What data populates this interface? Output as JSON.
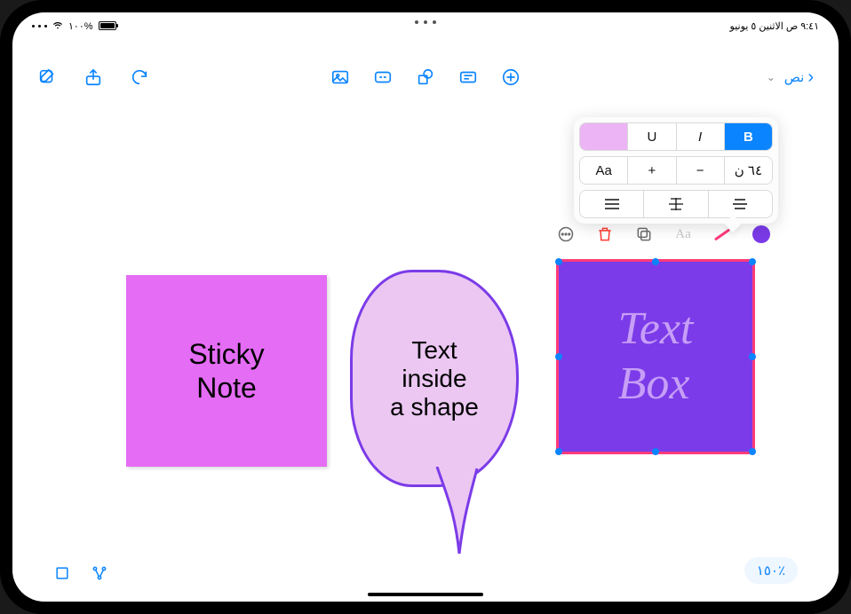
{
  "status_bar": {
    "time_date": "٩:٤١ ص  الاثنين ٥ يونيو",
    "battery_pct": "١٠٠%"
  },
  "toolbar": {
    "back_label": "نص",
    "tools": {
      "media": "media",
      "link": "link",
      "shapes": "shapes",
      "text": "text",
      "draw": "draw"
    }
  },
  "canvas": {
    "sticky_note_text": "Sticky\nNote",
    "shape_text": "Text\ninside\na shape",
    "text_box_text": "Text\nBox"
  },
  "format_popover": {
    "bold_label": "B",
    "italic_label": "I",
    "underline_label": "U",
    "color_swatch": "#ecb3f5",
    "font_size_label": "٦٤ ن",
    "decrease": "−",
    "increase": "+",
    "font_picker": "Aa",
    "align_right": "right",
    "align_center_strike": "center-strike",
    "align_justify": "justify"
  },
  "inline_tools": {
    "color": "#7b3be8",
    "text_style_label": "Aa"
  },
  "zoom_label": "١٥٠٪"
}
